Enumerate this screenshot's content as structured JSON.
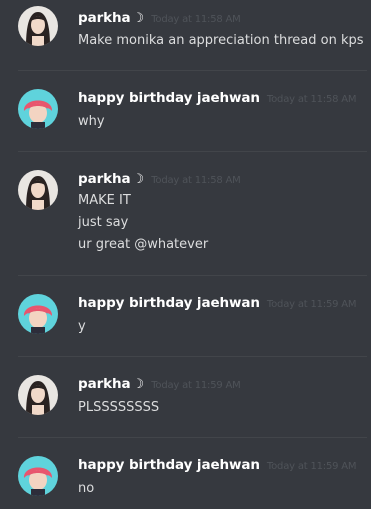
{
  "messages": [
    {
      "username": "parkha",
      "suffix": "☽",
      "timestamp": "Today at 11:58 AM",
      "avatar": "parkha-avatar",
      "lines": [
        "Make monika an appreciation thread on kps"
      ]
    },
    {
      "username": "happy birthday jaehwan",
      "suffix": "",
      "timestamp": "Today at 11:58 AM",
      "avatar": "jaehwan-avatar",
      "lines": [
        "why"
      ]
    },
    {
      "username": "parkha",
      "suffix": "☽",
      "timestamp": "Today at 11:58 AM",
      "avatar": "parkha-avatar",
      "lines": [
        "MAKE IT",
        "just say",
        "ur great @whatever"
      ]
    },
    {
      "username": "happy birthday jaehwan",
      "suffix": "",
      "timestamp": "Today at 11:59 AM",
      "avatar": "jaehwan-avatar",
      "lines": [
        "y"
      ]
    },
    {
      "username": "parkha",
      "suffix": "☽",
      "timestamp": "Today at 11:59 AM",
      "avatar": "parkha-avatar",
      "lines": [
        "PLSSSSSSSS"
      ]
    },
    {
      "username": "happy birthday jaehwan",
      "suffix": "",
      "timestamp": "Today at 11:59 AM",
      "avatar": "jaehwan-avatar",
      "lines": [
        "no"
      ]
    }
  ],
  "colors": {
    "background": "#36393f",
    "username": "#ffffff",
    "timestamp": "#4f5359",
    "message_text": "#dcddde",
    "divider": "#42454a",
    "parkha_avatar_bg": "#e9e6e2",
    "jaehwan_avatar_bg": "#5fd3dc",
    "jaehwan_hair": "#e8566e"
  }
}
